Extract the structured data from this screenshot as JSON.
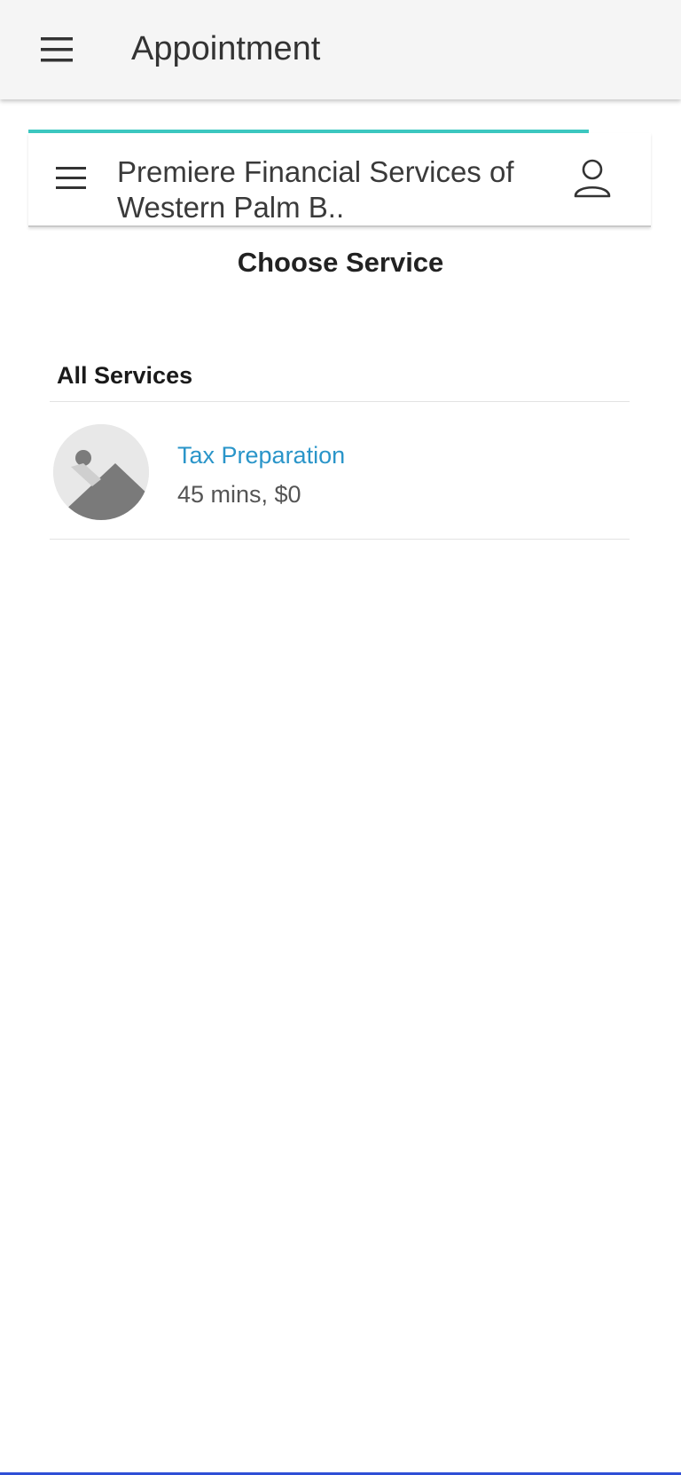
{
  "app_bar": {
    "title": "Appointment",
    "menu_icon": "hamburger-menu-icon"
  },
  "business": {
    "name": "Premiere Financial Services of Western Palm B..",
    "menu_icon": "hamburger-menu-icon",
    "user_icon": "user-profile-icon"
  },
  "page": {
    "section_title": "Choose Service"
  },
  "services": {
    "group_label": "All Services",
    "items": [
      {
        "name": "Tax Preparation",
        "meta": "45 mins, $0",
        "thumbnail_icon": "image-placeholder-icon"
      }
    ]
  },
  "colors": {
    "accent": "#3cc7c0",
    "link": "#2a95c9",
    "app_bar_bg": "#f5f5f5",
    "bottom_nav": "#2f4fd6"
  }
}
